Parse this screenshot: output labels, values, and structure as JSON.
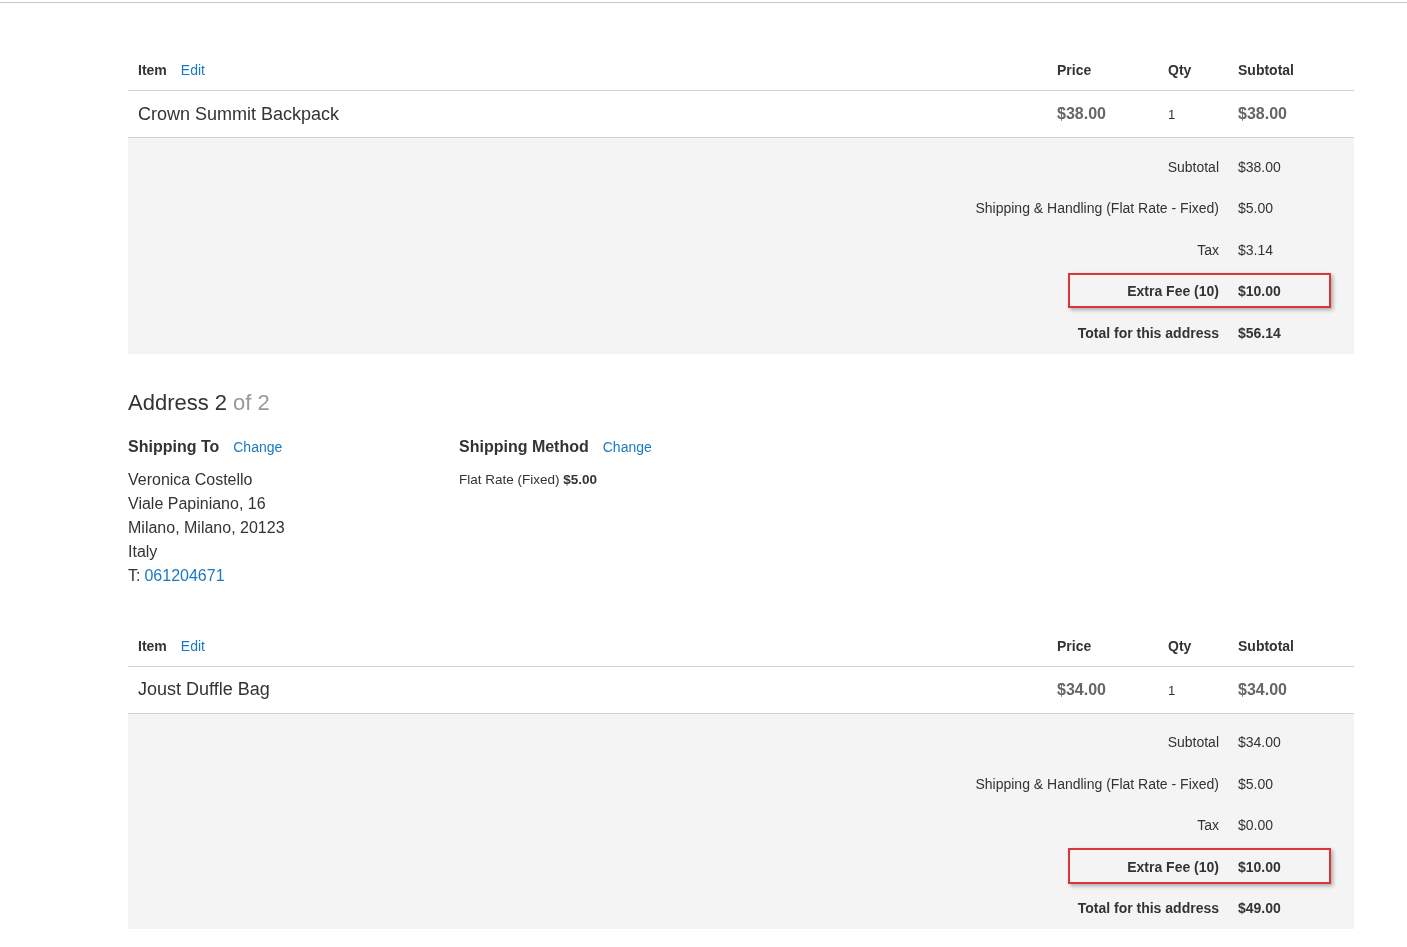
{
  "sections": [
    {
      "table": {
        "columns": [
          {
            "label": "Item",
            "edit": "Edit"
          },
          {
            "label": "Price"
          },
          {
            "label": "Qty"
          },
          {
            "label": "Subtotal"
          }
        ],
        "rows": [
          {
            "name": "Crown Summit Backpack",
            "price": "$38.00",
            "qty": "1",
            "subtotal": "$38.00"
          }
        ]
      },
      "totals": [
        {
          "kind": "normal",
          "label": "Subtotal",
          "value": "$38.00"
        },
        {
          "kind": "normal",
          "label": "Shipping & Handling (Flat Rate - Fixed)",
          "value": "$5.00"
        },
        {
          "kind": "normal",
          "label": "Tax",
          "value": "$3.14"
        },
        {
          "kind": "highlight",
          "label": "Extra Fee (10)",
          "value": "$10.00"
        },
        {
          "kind": "grand",
          "label": "Total for this address",
          "value": "$56.14"
        }
      ]
    },
    {
      "heading": {
        "title": "Address 2",
        "count": "of 2"
      },
      "shipping_to": {
        "title": "Shipping To",
        "action": "Change",
        "lines": [
          "Veronica Costello",
          "Viale Papiniano, 16",
          "Milano, Milano, 20123",
          "Italy"
        ],
        "phone_label": "T:",
        "phone": "061204671"
      },
      "shipping_method": {
        "title": "Shipping Method",
        "action": "Change",
        "text": "Flat Rate (Fixed) **$5.00**"
      },
      "table": {
        "columns": [
          {
            "label": "Item",
            "edit": "Edit"
          },
          {
            "label": "Price"
          },
          {
            "label": "Qty"
          },
          {
            "label": "Subtotal"
          }
        ],
        "rows": [
          {
            "name": "Joust Duffle Bag",
            "price": "$34.00",
            "qty": "1",
            "subtotal": "$34.00"
          }
        ]
      },
      "totals": [
        {
          "kind": "normal",
          "label": "Subtotal",
          "value": "$34.00"
        },
        {
          "kind": "normal",
          "label": "Shipping & Handling (Flat Rate - Fixed)",
          "value": "$5.00"
        },
        {
          "kind": "normal",
          "label": "Tax",
          "value": "$0.00"
        },
        {
          "kind": "highlight",
          "label": "Extra Fee (10)",
          "value": "$10.00"
        },
        {
          "kind": "grand",
          "label": "Total for this address",
          "value": "$49.00"
        }
      ]
    }
  ]
}
